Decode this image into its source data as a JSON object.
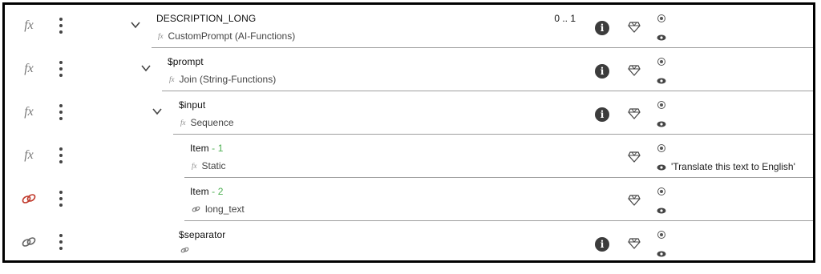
{
  "rows": [
    {
      "name": "DESCRIPTION_LONG",
      "idx": "",
      "sub": "CustomPrompt (AI-Functions)",
      "sub_icon": "fx",
      "left_icon": "fx",
      "card": "0 .. 1",
      "value": "",
      "has_info": true,
      "has_chevron": true
    },
    {
      "name": "$prompt",
      "idx": "",
      "sub": "Join (String-Functions)",
      "sub_icon": "fx",
      "left_icon": "fx",
      "card": "",
      "value": "",
      "has_info": true,
      "has_chevron": true
    },
    {
      "name": "$input",
      "idx": "",
      "sub": "Sequence",
      "sub_icon": "fx",
      "left_icon": "fx",
      "card": "",
      "value": "",
      "has_info": true,
      "has_chevron": true
    },
    {
      "name": "Item",
      "idx": " - 1",
      "sub": "Static",
      "sub_icon": "fx",
      "left_icon": "fx",
      "card": "",
      "value": "'Translate this text to English'",
      "has_info": false,
      "has_chevron": false
    },
    {
      "name": "Item",
      "idx": " - 2",
      "sub": "long_text",
      "sub_icon": "link",
      "left_icon": "link-red",
      "card": "",
      "value": "",
      "has_info": false,
      "has_chevron": false
    },
    {
      "name": "$separator",
      "idx": "",
      "sub": "",
      "sub_icon": "link",
      "left_icon": "link",
      "card": "",
      "value": "",
      "has_info": true,
      "has_chevron": false
    }
  ],
  "colors": {
    "index": "#4caf50",
    "link_red": "#c0392b",
    "border": "#000000"
  },
  "icons": {
    "fx": "function-icon",
    "link": "link-icon",
    "info": "info-icon",
    "gem": "gem-icon",
    "radio": "radio-icon",
    "eye": "eye-icon",
    "menu": "more-vert-icon",
    "chevron": "chevron-down-icon"
  }
}
